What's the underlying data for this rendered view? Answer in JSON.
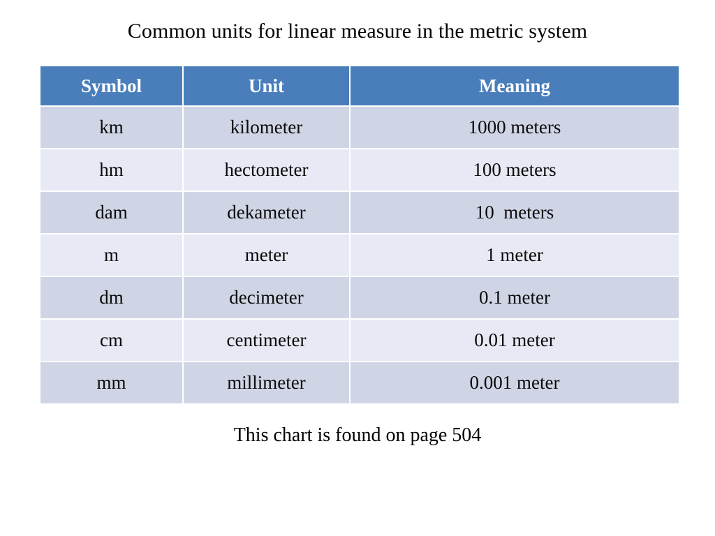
{
  "slide": {
    "title": "Common units for linear measure in the metric system",
    "footer_note": "This chart is found on page 504",
    "background_color": "#ffffff"
  },
  "colors": {
    "header_fill": "#4a7ebb",
    "header_text": "#ffffff",
    "row_odd_fill": "#d0d5e6",
    "row_even_fill": "#e7eaf4",
    "grid_line": "#ffffff",
    "body_text": "#000000"
  },
  "chart_data": {
    "type": "table",
    "title": "Common units for linear measure in the metric system",
    "columns": [
      "Symbol",
      "Unit",
      "Meaning"
    ],
    "rows": [
      [
        "km",
        "kilometer",
        "1000 meters"
      ],
      [
        "hm",
        "hectometer",
        "100 meters"
      ],
      [
        "dam",
        "dekameter",
        "10  meters"
      ],
      [
        "m",
        "meter",
        "1 meter"
      ],
      [
        "dm",
        "decimeter",
        "0.1 meter"
      ],
      [
        "cm",
        "centimeter",
        "0.01 meter"
      ],
      [
        "mm",
        "millimeter",
        "0.001 meter"
      ]
    ],
    "annotations": [
      "This chart is found on page 504"
    ]
  }
}
